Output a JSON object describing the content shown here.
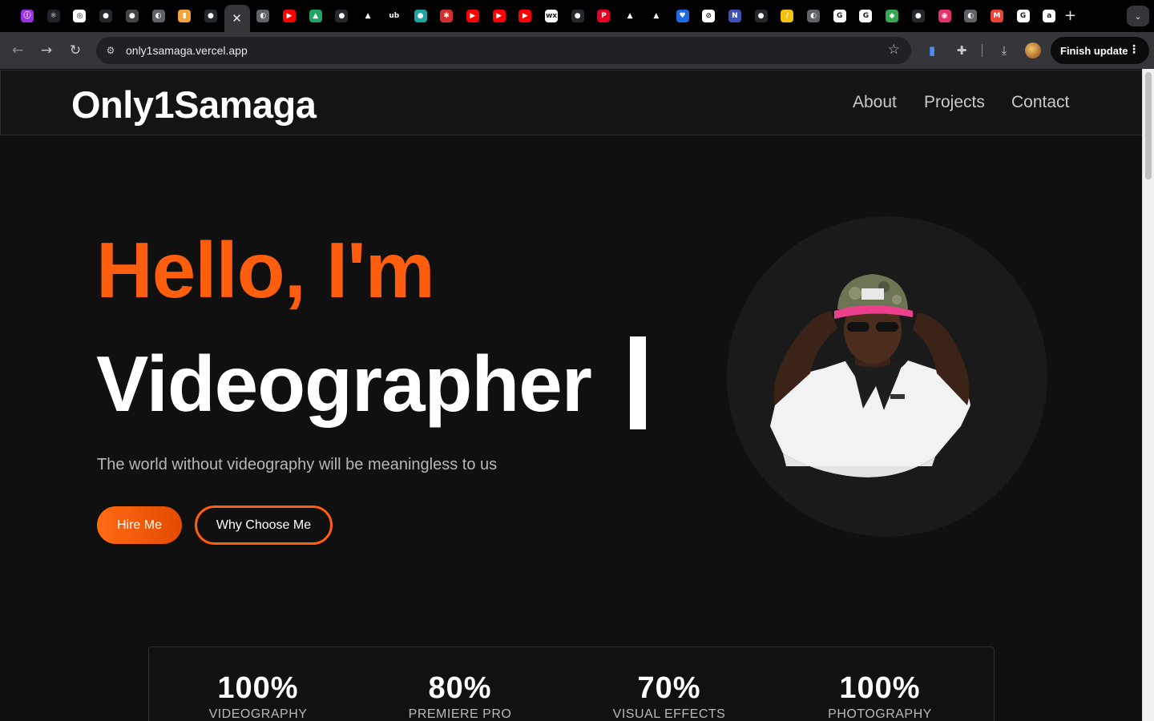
{
  "browser": {
    "tabs": [
      {
        "icon": "purple-app-icon",
        "color": "#9b30e6",
        "glyph": "ⓘ"
      },
      {
        "icon": "react-icon",
        "color": "#20232a",
        "glyph": "⚛"
      },
      {
        "icon": "openai-icon",
        "color": "#ffffff",
        "glyph": "◎"
      },
      {
        "icon": "github-icon",
        "color": "#24292e",
        "glyph": "●"
      },
      {
        "icon": "github-icon",
        "color": "#444444",
        "glyph": "●"
      },
      {
        "icon": "globe-icon",
        "color": "#5f6368",
        "glyph": "◐"
      },
      {
        "icon": "bottle-icon",
        "color": "#f2a33a",
        "glyph": "▮"
      },
      {
        "icon": "github-icon",
        "color": "#24292e",
        "glyph": "●"
      },
      {
        "icon": "close-icon",
        "color": "#35363a",
        "glyph": "✕"
      },
      {
        "icon": "globe-icon",
        "color": "#5f6368",
        "glyph": "◐"
      },
      {
        "icon": "youtube-icon",
        "color": "#ff0000",
        "glyph": "▶"
      },
      {
        "icon": "drive-icon",
        "color": "#1fa463",
        "glyph": "▲"
      },
      {
        "icon": "github-icon",
        "color": "#24292e",
        "glyph": "●"
      },
      {
        "icon": "vercel-icon",
        "color": "#000000",
        "glyph": "▲"
      },
      {
        "icon": "ub-icon",
        "color": "#000000",
        "glyph": "ub"
      },
      {
        "icon": "teal-app-icon",
        "color": "#1fa3a3",
        "glyph": "●"
      },
      {
        "icon": "red-app-icon",
        "color": "#d32f2f",
        "glyph": "✱"
      },
      {
        "icon": "youtube-icon",
        "color": "#ff0000",
        "glyph": "▶"
      },
      {
        "icon": "youtube-icon",
        "color": "#ff0000",
        "glyph": "▶"
      },
      {
        "icon": "youtube-icon",
        "color": "#ff0000",
        "glyph": "▶"
      },
      {
        "icon": "wix-icon",
        "color": "#ffffff",
        "glyph": "wx"
      },
      {
        "icon": "github-icon",
        "color": "#24292e",
        "glyph": "●"
      },
      {
        "icon": "pinterest-icon",
        "color": "#e60023",
        "glyph": "P"
      },
      {
        "icon": "vercel-icon",
        "color": "#000000",
        "glyph": "▲"
      },
      {
        "icon": "vercel-icon",
        "color": "#000000",
        "glyph": "▲"
      },
      {
        "icon": "heart-icon",
        "color": "#1d6ae5",
        "glyph": "♥"
      },
      {
        "icon": "slash-icon",
        "color": "#ffffff",
        "glyph": "⊘"
      },
      {
        "icon": "n-app-icon",
        "color": "#3f51b5",
        "glyph": "N"
      },
      {
        "icon": "github-icon",
        "color": "#24292e",
        "glyph": "●"
      },
      {
        "icon": "yellow-app-icon",
        "color": "#f4c20d",
        "glyph": "/"
      },
      {
        "icon": "globe-icon",
        "color": "#5f6368",
        "glyph": "◐"
      },
      {
        "icon": "google-icon",
        "color": "#ffffff",
        "glyph": "G"
      },
      {
        "icon": "google-icon",
        "color": "#ffffff",
        "glyph": "G"
      },
      {
        "icon": "maps-icon",
        "color": "#34a853",
        "glyph": "◆"
      },
      {
        "icon": "github-icon",
        "color": "#24292e",
        "glyph": "●"
      },
      {
        "icon": "instagram-icon",
        "color": "#e1306c",
        "glyph": "◉"
      },
      {
        "icon": "globe-icon",
        "color": "#5f6368",
        "glyph": "◐"
      },
      {
        "icon": "gmail-icon",
        "color": "#ea4335",
        "glyph": "M"
      },
      {
        "icon": "google-icon",
        "color": "#ffffff",
        "glyph": "G"
      },
      {
        "icon": "amazon-icon",
        "color": "#ffffff",
        "glyph": "a"
      }
    ],
    "new_tab": "+",
    "tab_search": "⌄",
    "url": "only1samaga.vercel.app",
    "finish_update_label": "Finish update"
  },
  "site": {
    "logo": "Only1Samaga",
    "nav": [
      "About",
      "Projects",
      "Contact"
    ],
    "hero": {
      "greeting": "Hello, I'm",
      "role": "Videographer",
      "tagline": "The world without videography will be meaningless to us",
      "hire_label": "Hire Me",
      "why_label": "Why Choose Me"
    },
    "stats": [
      {
        "value": "100%",
        "label": "VIDEOGRAPHY"
      },
      {
        "value": "80%",
        "label": "PREMIERE PRO"
      },
      {
        "value": "70%",
        "label": "VISUAL EFFECTS"
      },
      {
        "value": "100%",
        "label": "PHOTOGRAPHY"
      }
    ],
    "accent_color": "#ff5e0e"
  }
}
